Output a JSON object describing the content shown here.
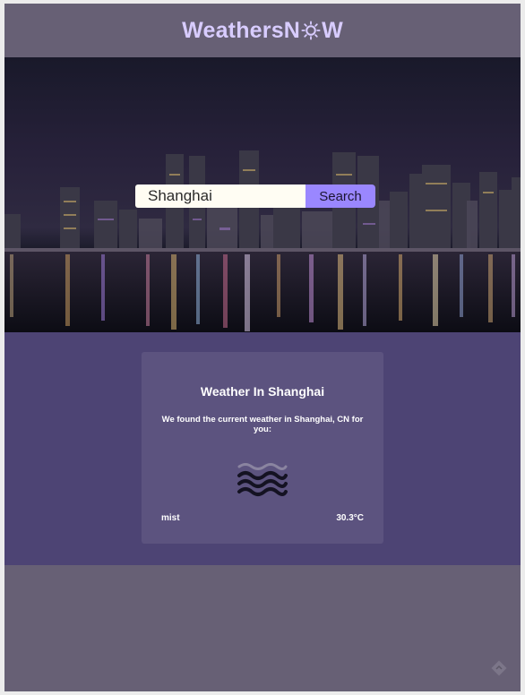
{
  "brand": {
    "prefix": "WeathersN",
    "suffix": "W",
    "color": "#d8ccff"
  },
  "search": {
    "value": "Shanghai",
    "button_label": "Search",
    "accent": "#9a87ff"
  },
  "result": {
    "title": "Weather In Shanghai",
    "message": "We found the current weather in Shanghai, CN for you:",
    "icon": "mist-icon",
    "description": "mist",
    "temperature": "30.3°C"
  },
  "footer": {
    "icon": "diamond-logo-icon"
  }
}
